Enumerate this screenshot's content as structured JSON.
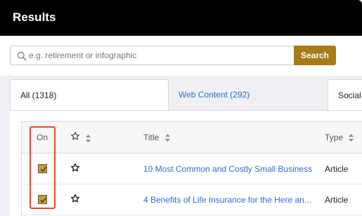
{
  "header": {
    "title": "Results"
  },
  "search": {
    "placeholder": "e.g. retirement or infographic",
    "value": "",
    "button_label": "Search"
  },
  "tabs": [
    {
      "label": "All (1318)",
      "active": true
    },
    {
      "label": "Web Content (292)",
      "active": false
    },
    {
      "label": "Social",
      "active": false
    }
  ],
  "table": {
    "columns": {
      "on": "On",
      "title": "Title",
      "type": "Type"
    },
    "rows": [
      {
        "on": true,
        "starred": false,
        "title": "10 Most Common and Costly Small Business...",
        "type": "Article"
      },
      {
        "on": true,
        "starred": false,
        "title": "4 Benefits of Life Insurance for the Here an...",
        "type": "Article"
      }
    ]
  },
  "icons": {
    "search": "search-icon",
    "star": "star-outline-icon",
    "sort": "sort-icon",
    "check": "check-icon"
  },
  "colors": {
    "header_bg": "#000000",
    "accent_gold": "#a67b1a",
    "checkbox_fill": "#c99a32",
    "link_blue": "#2e6bd8",
    "highlight_red": "#e2492f",
    "tab_area_bg": "#eef0f3"
  }
}
